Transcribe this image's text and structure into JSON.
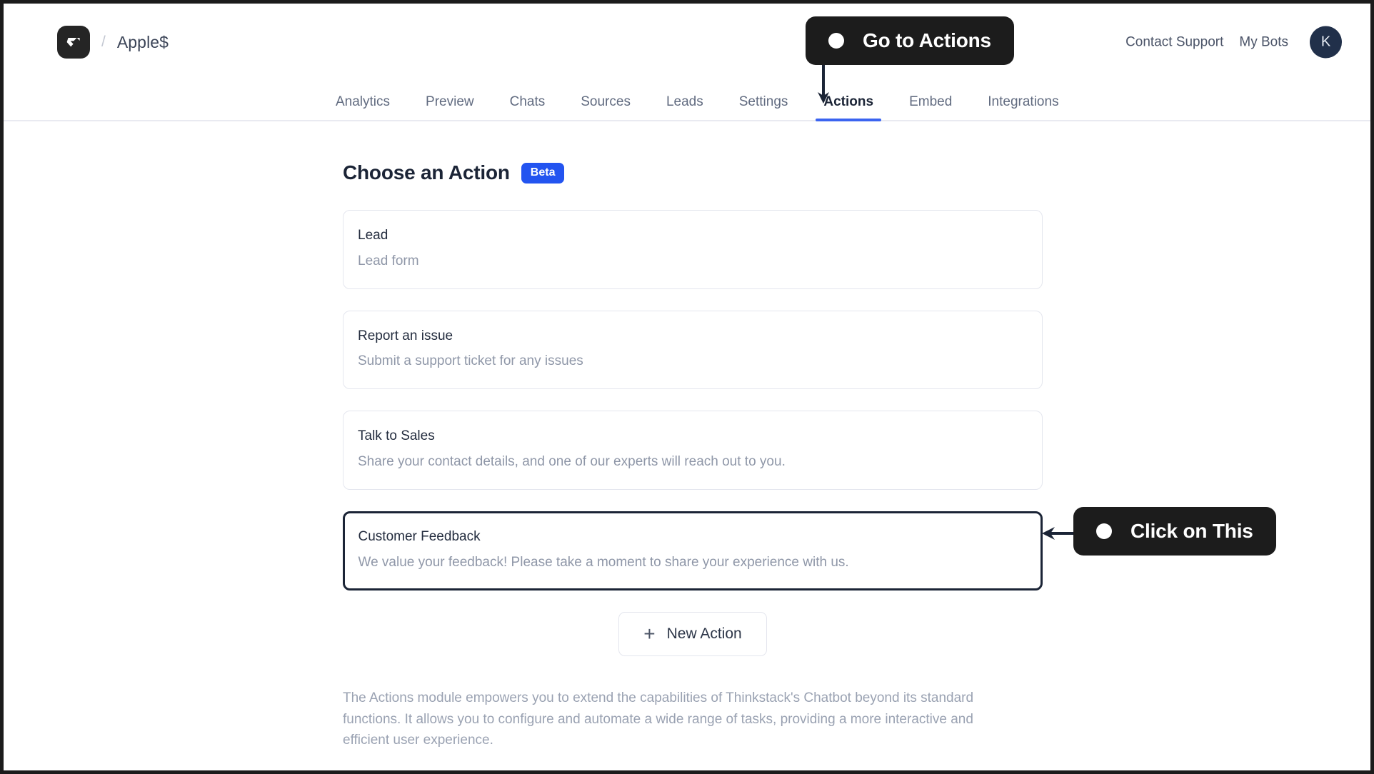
{
  "header": {
    "logo_icon": "thinkstack-logo-icon",
    "separator": "/",
    "bot_name": "Apple$",
    "contact_support": "Contact Support",
    "my_bots": "My Bots",
    "avatar_initial": "K"
  },
  "tabs": [
    {
      "label": "Analytics",
      "active": false
    },
    {
      "label": "Preview",
      "active": false
    },
    {
      "label": "Chats",
      "active": false
    },
    {
      "label": "Sources",
      "active": false
    },
    {
      "label": "Leads",
      "active": false
    },
    {
      "label": "Settings",
      "active": false
    },
    {
      "label": "Actions",
      "active": true
    },
    {
      "label": "Embed",
      "active": false
    },
    {
      "label": "Integrations",
      "active": false
    }
  ],
  "main": {
    "page_title": "Choose an Action",
    "beta_badge": "Beta",
    "actions": [
      {
        "title": "Lead",
        "description": "Lead form",
        "selected": false
      },
      {
        "title": "Report an issue",
        "description": "Submit a support ticket for any issues",
        "selected": false
      },
      {
        "title": "Talk to Sales",
        "description": "Share your contact details, and one of our experts will reach out to you.",
        "selected": false
      },
      {
        "title": "Customer Feedback",
        "description": "We value your feedback! Please take a moment to share your experience with us.",
        "selected": true
      }
    ],
    "new_action_label": "New Action",
    "new_action_icon": "plus-icon",
    "module_description": "The Actions module empowers you to extend the capabilities of Thinkstack's Chatbot beyond its standard functions. It allows you to configure and automate a wide range of tasks, providing a more interactive and efficient user experience."
  },
  "coachmarks": [
    {
      "label": "Go to Actions",
      "direction": "down"
    },
    {
      "label": "Click on This",
      "direction": "left"
    }
  ],
  "colors": {
    "accent_blue": "#3b64f0",
    "beta_badge_blue": "#2354f0",
    "coachmark_dark": "#1c1c1c",
    "selected_border": "#1b2436",
    "muted_text": "#8f97a8"
  }
}
